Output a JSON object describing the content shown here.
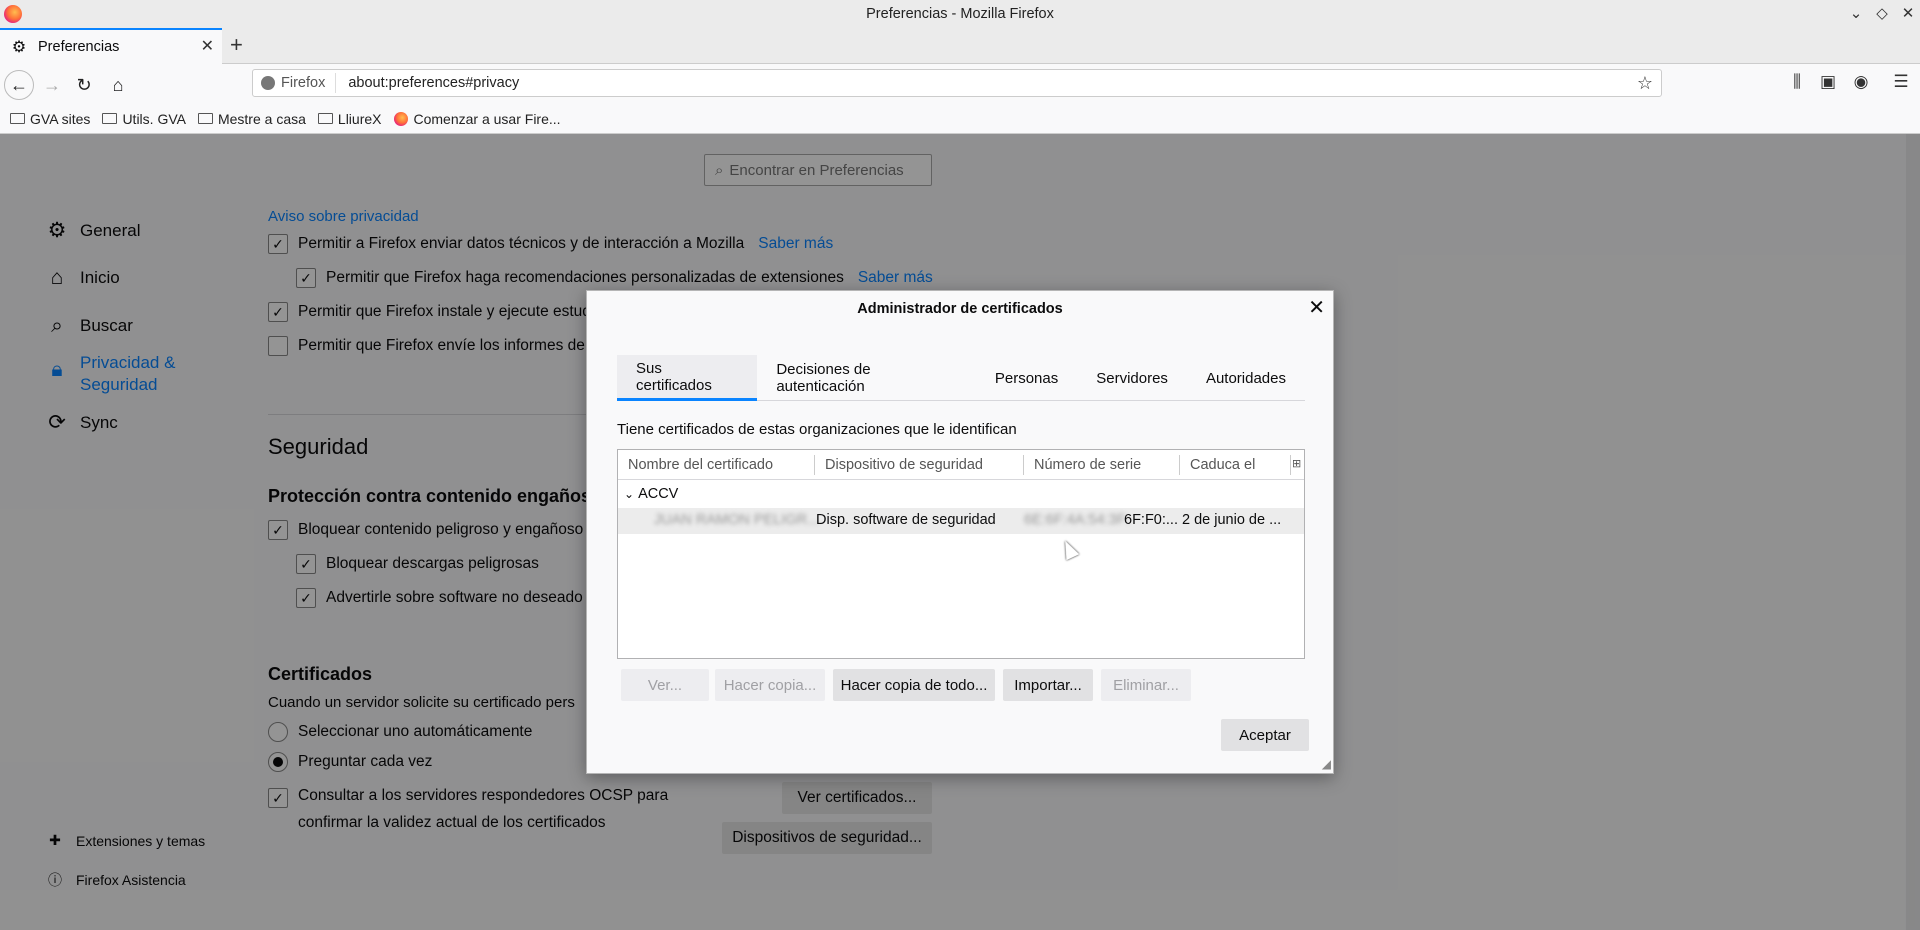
{
  "window": {
    "title": "Preferencias - Mozilla Firefox"
  },
  "tab": {
    "label": "Preferencias",
    "icon": "gear-icon"
  },
  "urlbar": {
    "identity": "Firefox",
    "url": "about:preferences#privacy"
  },
  "bookmarks": [
    {
      "label": "GVA sites",
      "icon": "folder-icon"
    },
    {
      "label": "Utils. GVA",
      "icon": "folder-icon"
    },
    {
      "label": "Mestre a casa",
      "icon": "folder-icon"
    },
    {
      "label": "LliureX",
      "icon": "folder-icon"
    },
    {
      "label": "Comenzar a usar Fire...",
      "icon": "firefox-icon"
    }
  ],
  "prefs": {
    "search_placeholder": "Encontrar en Preferencias",
    "sidebar": [
      {
        "label": "General",
        "icon": "gear-icon"
      },
      {
        "label": "Inicio",
        "icon": "home-icon"
      },
      {
        "label": "Buscar",
        "icon": "search-icon"
      },
      {
        "label": "Privacidad &\nSeguridad",
        "icon": "lock-icon",
        "active": true
      },
      {
        "label": "Sync",
        "icon": "sync-icon"
      }
    ],
    "sidebar_bottom": [
      {
        "label": "Extensiones y temas",
        "icon": "puzzle-icon"
      },
      {
        "label": "Firefox Asistencia",
        "icon": "help-icon"
      }
    ],
    "privacy_link": "Aviso sobre privacidad",
    "data_rows": [
      {
        "label": "Permitir a Firefox enviar datos técnicos y de interacción a Mozilla",
        "checked": true,
        "link": "Saber más"
      },
      {
        "label": "Permitir que Firefox haga recomendaciones personalizadas de extensiones",
        "checked": true,
        "link": "Saber más"
      },
      {
        "label": "Permitir que Firefox instale y ejecute estud",
        "checked": true
      },
      {
        "label": "Permitir que Firefox envíe los informes de",
        "checked": false
      }
    ],
    "security_heading": "Seguridad",
    "deceptive_heading": "Protección contra contenido engañoso",
    "deceptive_rows": [
      {
        "label": "Bloquear contenido peligroso y engañoso",
        "checked": true
      },
      {
        "label": "Bloquear descargas peligrosas",
        "checked": true
      },
      {
        "label": "Advertirle sobre software no deseado",
        "checked": true
      }
    ],
    "certs_heading": "Certificados",
    "certs_desc": "Cuando un servidor solicite su certificado pers",
    "radio_auto": "Seleccionar uno automáticamente",
    "radio_ask": "Preguntar cada vez",
    "ocsp_line1": "Consultar a los servidores respondedores OCSP para",
    "ocsp_line2": "confirmar la validez actual de los certificados",
    "btn_view_certs": "Ver certificados...",
    "btn_security_devices": "Dispositivos de seguridad..."
  },
  "dialog": {
    "title": "Administrador de certificados",
    "tabs": [
      "Sus certificados",
      "Decisiones de autenticación",
      "Personas",
      "Servidores",
      "Autoridades"
    ],
    "description": "Tiene certificados de estas organizaciones que le identifican",
    "columns": [
      "Nombre del certificado",
      "Dispositivo de seguridad",
      "Número de serie",
      "Caduca el"
    ],
    "group": "ACCV",
    "row": {
      "name": "JUAN RAMON PELIGR...",
      "device": "Disp. software de seguridad",
      "serial": "6F:F0:...",
      "serial_prefix": "6E:6F:4A:54:3F:",
      "expires": "2 de junio de ..."
    },
    "buttons": [
      {
        "label": "Ver...",
        "disabled": true
      },
      {
        "label": "Hacer copia...",
        "disabled": true
      },
      {
        "label": "Hacer copia de todo...",
        "disabled": false
      },
      {
        "label": "Importar...",
        "disabled": false
      },
      {
        "label": "Eliminar...",
        "disabled": true
      }
    ],
    "accept": "Aceptar"
  }
}
